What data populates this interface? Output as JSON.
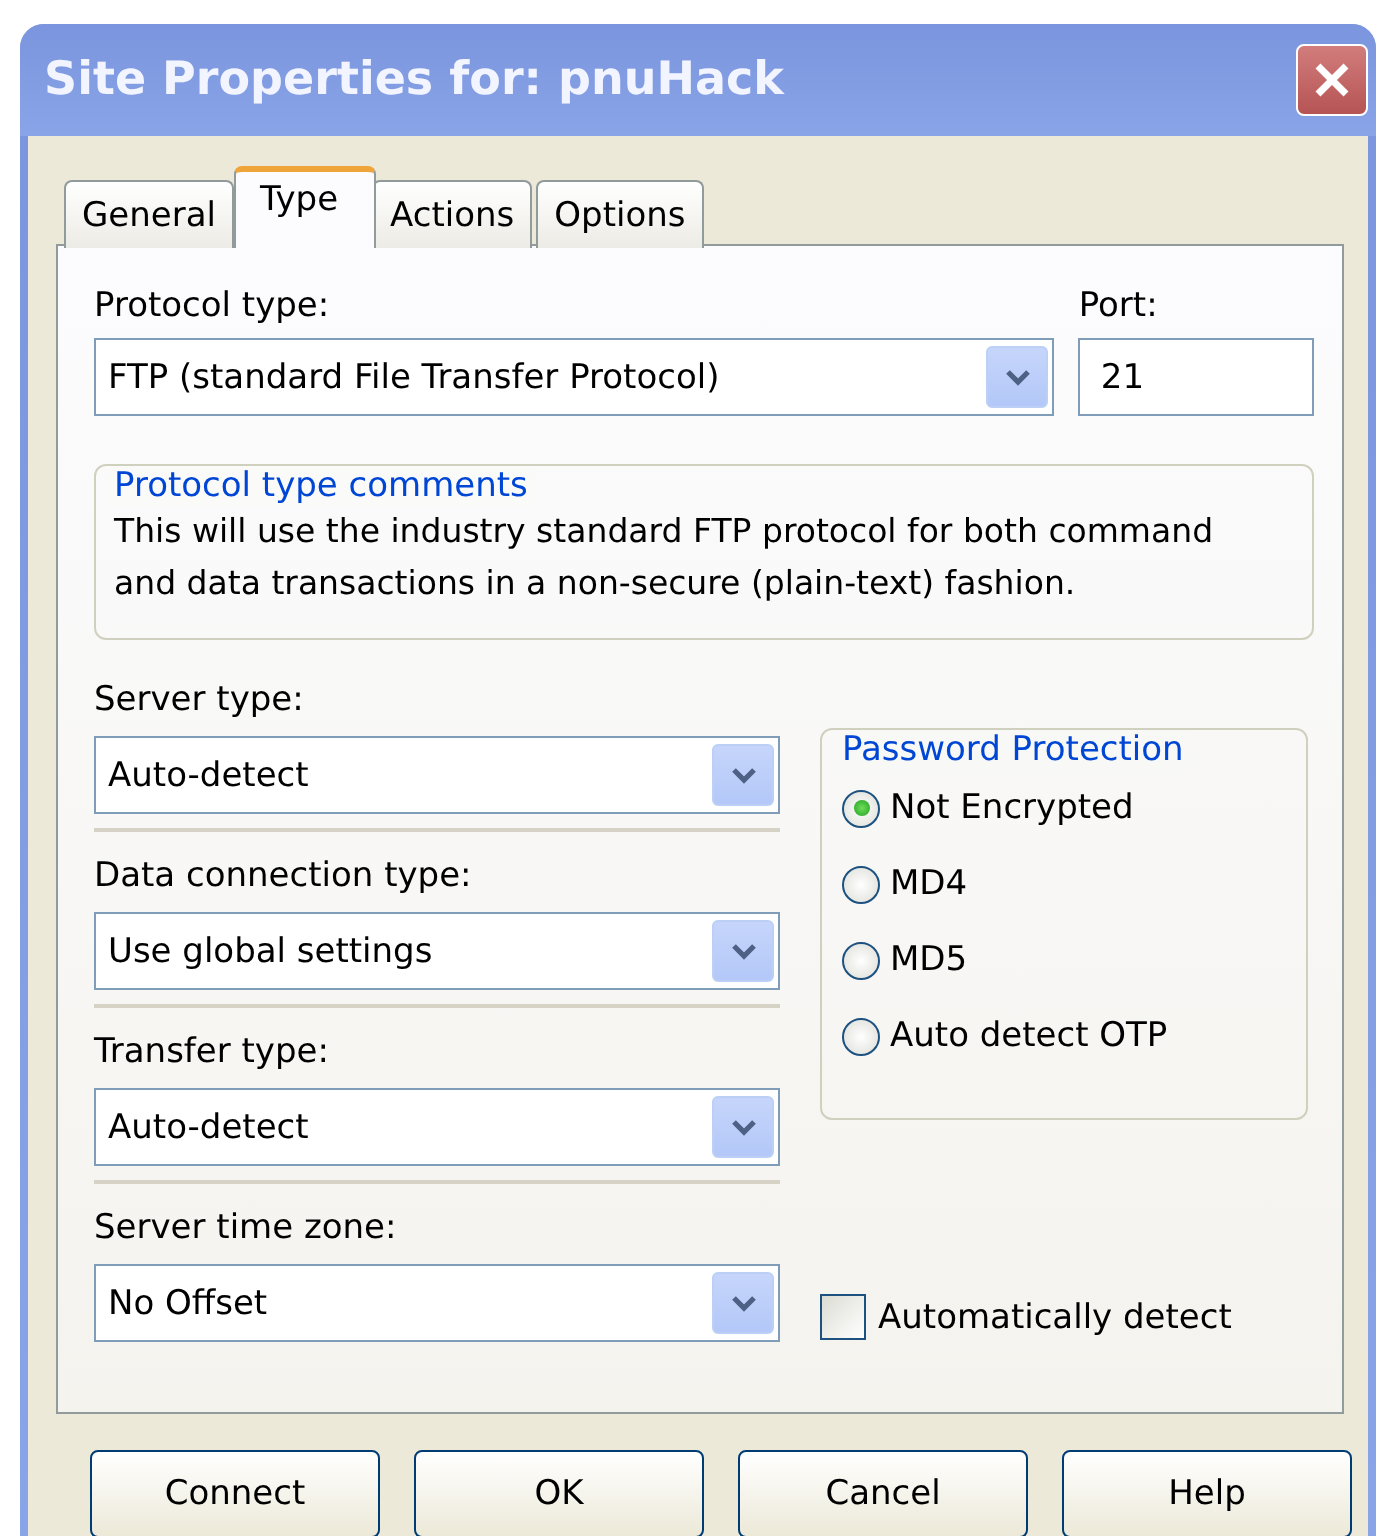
{
  "window": {
    "title": "Site Properties for: pnuHack"
  },
  "tabs": [
    {
      "label": "General",
      "selected": false
    },
    {
      "label": "Type",
      "selected": true
    },
    {
      "label": "Actions",
      "selected": false
    },
    {
      "label": "Options",
      "selected": false
    }
  ],
  "protocol": {
    "label": "Protocol type:",
    "value": "FTP (standard File Transfer Protocol)"
  },
  "port": {
    "label": "Port:",
    "value": "21"
  },
  "comments": {
    "title": "Protocol type comments",
    "text": "This will use the industry standard FTP protocol for both command and data transactions in a non-secure (plain-text) fashion."
  },
  "settings": [
    {
      "label": "Server type:",
      "value": "Auto-detect"
    },
    {
      "label": "Data connection type:",
      "value": "Use global settings"
    },
    {
      "label": "Transfer type:",
      "value": "Auto-detect"
    },
    {
      "label": "Server time zone:",
      "value": "No Offset"
    }
  ],
  "password_protection": {
    "title": "Password Protection",
    "options": [
      {
        "label": "Not Encrypted",
        "selected": true
      },
      {
        "label": "MD4",
        "selected": false
      },
      {
        "label": "MD5",
        "selected": false
      },
      {
        "label": "Auto detect OTP",
        "selected": false
      }
    ]
  },
  "auto_detect": {
    "label": "Automatically detect",
    "checked": false
  },
  "buttons": [
    "Connect",
    "OK",
    "Cancel",
    "Help"
  ]
}
